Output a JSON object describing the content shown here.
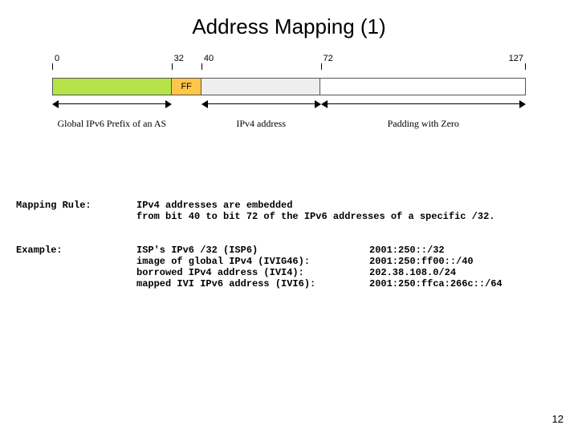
{
  "title": "Address Mapping (1)",
  "diagram": {
    "bit_ticks": [
      {
        "pos": 0,
        "label": "0"
      },
      {
        "pos": 32,
        "label": "32"
      },
      {
        "pos": 40,
        "label": "40"
      },
      {
        "pos": 72,
        "label": "72"
      },
      {
        "pos": 127,
        "label": "127",
        "align": "right"
      }
    ],
    "segments": [
      {
        "name": "prefix",
        "text": "",
        "bits": 32,
        "class": "seg-prefix"
      },
      {
        "name": "ff",
        "text": "FF",
        "bits": 8,
        "class": "seg-ff"
      },
      {
        "name": "v4",
        "text": "",
        "bits": 32,
        "class": "seg-v4"
      },
      {
        "name": "pad",
        "text": "",
        "bits": 55,
        "class": "seg-pad"
      }
    ],
    "ranges": [
      {
        "name": "prefix",
        "label": "Global IPv6 Prefix of an AS",
        "from": 0,
        "to": 32
      },
      {
        "name": "v4",
        "label": "IPv4 address",
        "from": 40,
        "to": 72
      },
      {
        "name": "pad",
        "label": "Padding with Zero",
        "from": 72,
        "to": 127
      }
    ]
  },
  "mapping_rule": {
    "label": "Mapping Rule:",
    "line1": "IPv4 addresses are embedded",
    "line2": "from bit 40 to bit 72 of the IPv6 addresses of a specific /32."
  },
  "example": {
    "label": "Example:",
    "rows": [
      {
        "desc": "ISP's IPv6 /32 (ISP6)",
        "val": "2001:250::/32"
      },
      {
        "desc": "image of global IPv4 (IVIG46):",
        "val": "2001:250:ff00::/40"
      },
      {
        "desc": "borrowed IPv4 address (IVI4):",
        "val": "202.38.108.0/24"
      },
      {
        "desc": "mapped IVI IPv6 address (IVI6):",
        "val": "2001:250:ffca:266c::/64"
      }
    ]
  },
  "page_number": "12"
}
